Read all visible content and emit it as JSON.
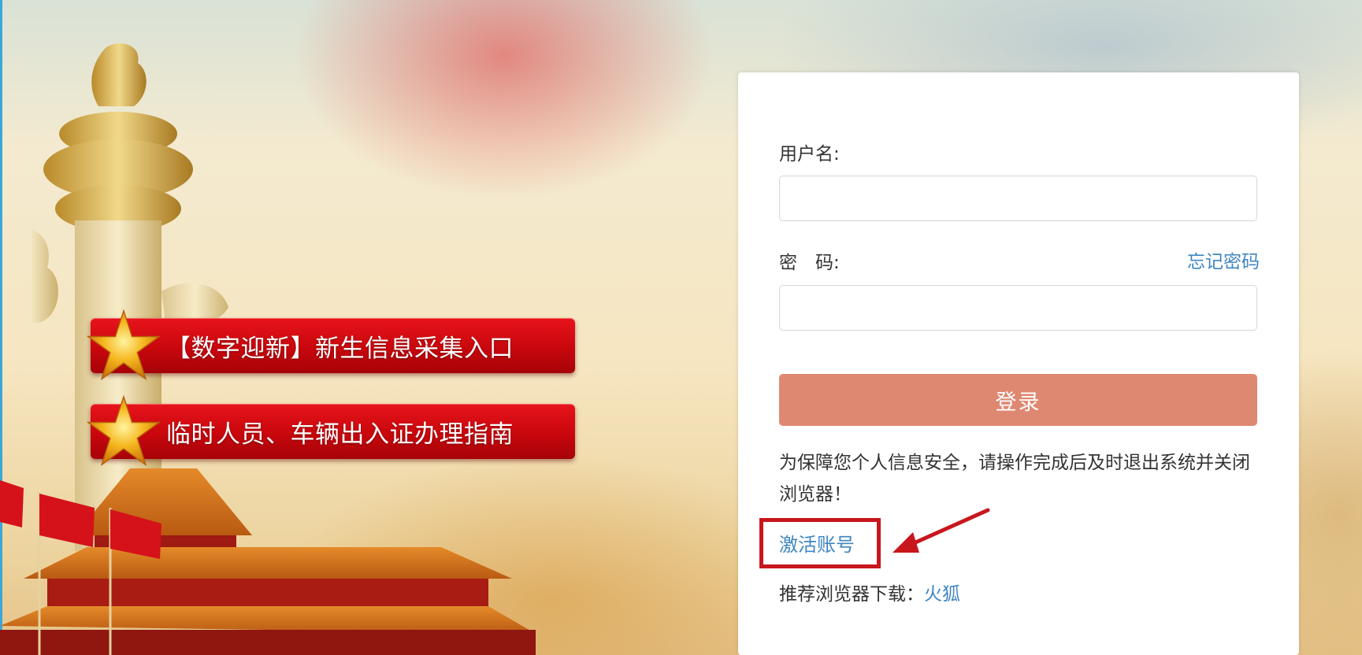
{
  "banners": [
    {
      "label": "【数字迎新】新生信息采集入口",
      "icon": "star-icon"
    },
    {
      "label": "临时人员、车辆出入证办理指南",
      "icon": "star-icon"
    }
  ],
  "login": {
    "username_label": "用户名:",
    "password_label": "密　码:",
    "forgot_password": "忘记密码",
    "username_value": "",
    "password_value": "",
    "submit_label": "登录",
    "security_notice": "为保障您个人信息安全，请操作完成后及时退出系统并关闭浏览器！",
    "activate_account": "激活账号",
    "recommend_prefix": "推荐浏览器下载：",
    "recommend_browser": "火狐"
  },
  "colors": {
    "login_button": "#de8872",
    "link": "#3f86c2",
    "banner_red": "#d10a10",
    "highlight": "#c8161d"
  }
}
